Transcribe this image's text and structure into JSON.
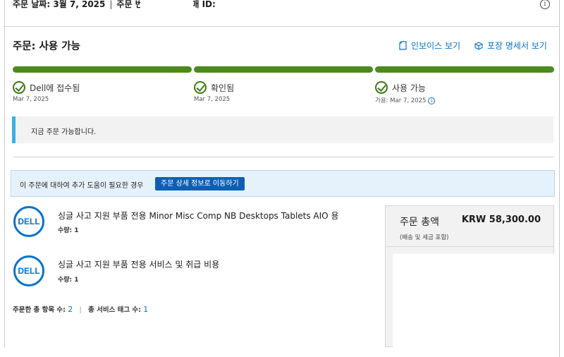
{
  "meta": {
    "order_date": "주문 날짜: 3월 7, 2025",
    "order_number_label": "주문 번호",
    "dell_purchase_id_label": "Dell 구매 ID:"
  },
  "header": {
    "status_title": "주문: 사용 가능",
    "invoice_link": "인보이스 보기",
    "packing_link": "포장 명세서 보기"
  },
  "progress": {
    "steps": [
      {
        "label": "Dell에 접수됨",
        "date": "Mar 7, 2025"
      },
      {
        "label": "확인됨",
        "date": "Mar 7, 2025"
      },
      {
        "label": "사용 가능",
        "date": "가용: Mar 7, 2025"
      }
    ],
    "color": "#4b8b1d",
    "completed_fraction": 1.0
  },
  "notice": {
    "text": "지금 주문 가능합니다."
  },
  "help": {
    "text": "이 주문에 대하여 추가 도움이 필요한 경우",
    "button_label": "주문 상세 정보로 이동하기"
  },
  "items": [
    {
      "logo": "DELL",
      "name": "싱글 사고 지원 부품 전용 Minor Misc Comp NB Desktops Tablets AIO 용",
      "qty": "수량: 1"
    },
    {
      "logo": "DELL",
      "name": "싱글 사고 지원 부품 전용 서비스 및 취급 비용",
      "qty": "수량: 1"
    }
  ],
  "totals": {
    "items_label": "주문한 총 항목 수:",
    "items_count": "2",
    "tags_label": "총 서비스 태그 수:",
    "tags_count": "1"
  },
  "summary": {
    "title": "주문 총액",
    "amount": "KRW 58,300.00",
    "subtitle": "(배송 및 세금 포함)"
  },
  "colors": {
    "link": "#0672cb",
    "button": "#0d5fb3",
    "notice_accent": "#3ab0e6",
    "help_bg": "#e6f2fb"
  }
}
